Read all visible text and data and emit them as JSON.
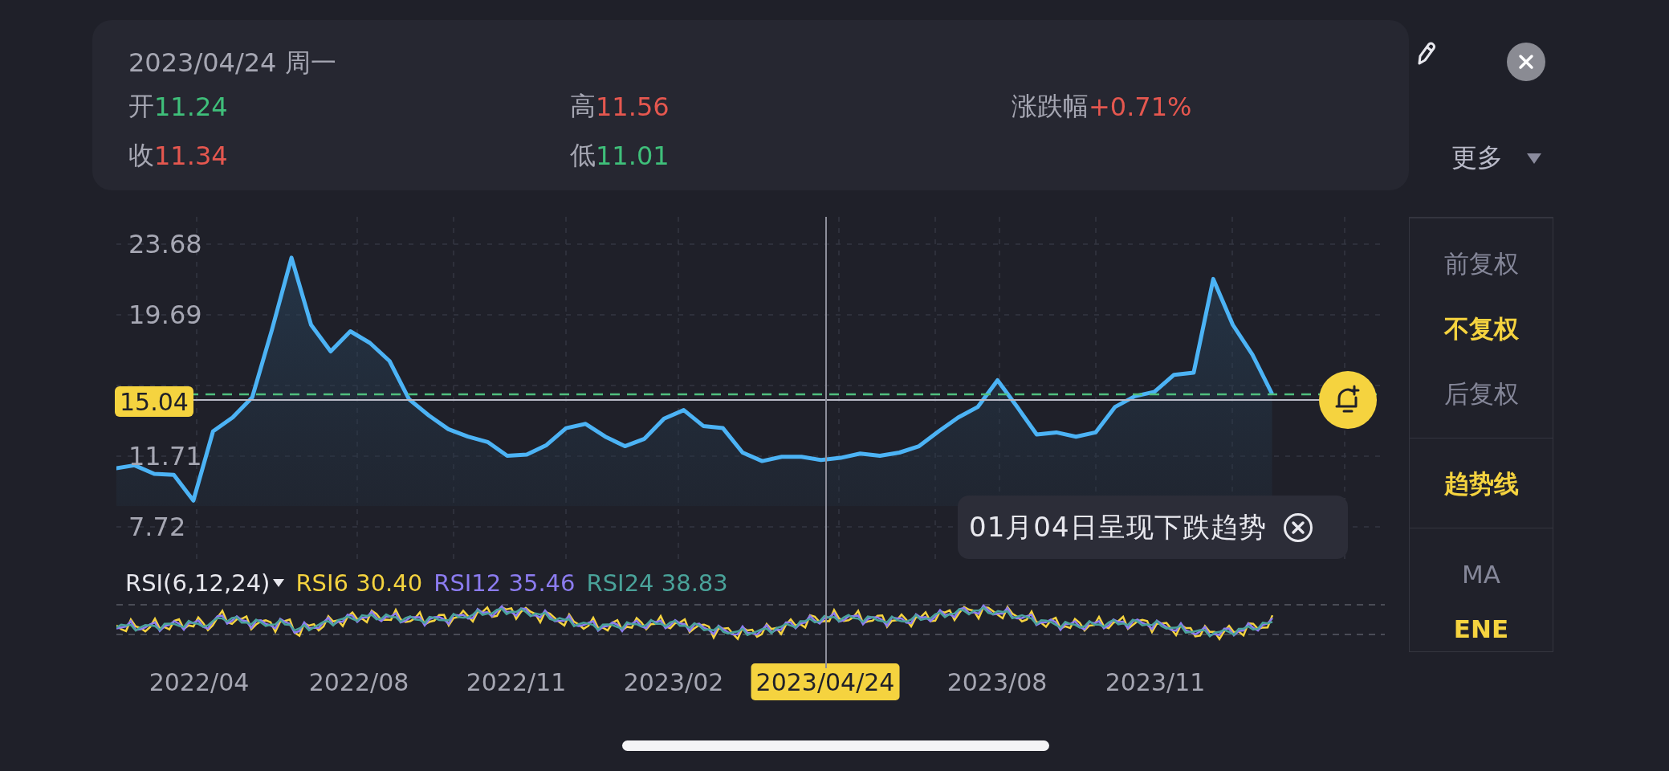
{
  "header": {
    "date": "2023/04/24 周一",
    "fields": [
      {
        "label": "开",
        "value": "11.24",
        "color": "#3fbf7a"
      },
      {
        "label": "高",
        "value": "11.56",
        "color": "#e5574f"
      },
      {
        "label": "涨跌幅",
        "value": "+0.71%",
        "color": "#e5574f"
      },
      {
        "label": "收",
        "value": "11.34",
        "color": "#e5574f"
      },
      {
        "label": "低",
        "value": "11.01",
        "color": "#3fbf7a"
      }
    ]
  },
  "more_menu": {
    "label": "更多"
  },
  "side_menu": {
    "groups": [
      {
        "items": [
          {
            "label": "前复权",
            "selected": false
          },
          {
            "label": "不复权",
            "selected": true
          },
          {
            "label": "后复权",
            "selected": false
          }
        ]
      },
      {
        "items": [
          {
            "label": "趋势线",
            "selected": true
          }
        ]
      },
      {
        "items": [
          {
            "label": "MA",
            "selected": false
          },
          {
            "label": "ENE",
            "selected": true
          }
        ]
      }
    ]
  },
  "chart": {
    "chart_data": {
      "type": "area",
      "ylim": [
        5.72,
        25.22
      ],
      "yticks": [
        7.72,
        11.71,
        19.69,
        23.68
      ],
      "grid": true,
      "series": [
        {
          "color": "#4cb3f5",
          "values": [
            11.01,
            11.19,
            10.71,
            10.65,
            9.2,
            13.11,
            13.89,
            15.03,
            18.82,
            22.91,
            19.12,
            17.62,
            18.76,
            18.1,
            17.08,
            14.91,
            14.01,
            13.23,
            12.81,
            12.51,
            11.73,
            11.79,
            12.33,
            13.29,
            13.53,
            12.81,
            12.27,
            12.69,
            13.83,
            14.31,
            13.41,
            13.29,
            11.91,
            11.43,
            11.67,
            11.67,
            11.49,
            11.61,
            11.85,
            11.73,
            11.91,
            12.27,
            13.11,
            13.89,
            14.49,
            15.99,
            14.49,
            12.93,
            13.05,
            12.81,
            13.05,
            14.49,
            15.09,
            15.34,
            16.3,
            16.42,
            21.71,
            19.12,
            17.44,
            15.22
          ]
        }
      ]
    },
    "price_badge": "15.04",
    "trend_note": "01月04日呈现下跌趋势",
    "rsi": {
      "label": "RSI(6,12,24)",
      "series": [
        {
          "name": "RSI6",
          "value": "30.40",
          "color": "#f5d33f"
        },
        {
          "name": "RSI12",
          "value": "35.46",
          "color": "#8c7cf0"
        },
        {
          "name": "RSI24",
          "value": "38.83",
          "color": "#4aa39a"
        }
      ]
    },
    "x_labels": [
      {
        "label": "2022/04",
        "selected": false
      },
      {
        "label": "2022/08",
        "selected": false
      },
      {
        "label": "2022/11",
        "selected": false
      },
      {
        "label": "2023/02",
        "selected": false
      },
      {
        "label": "2023/04/24",
        "selected": true
      },
      {
        "label": "2023/08",
        "selected": false
      },
      {
        "label": "2023/11",
        "selected": false
      }
    ]
  }
}
